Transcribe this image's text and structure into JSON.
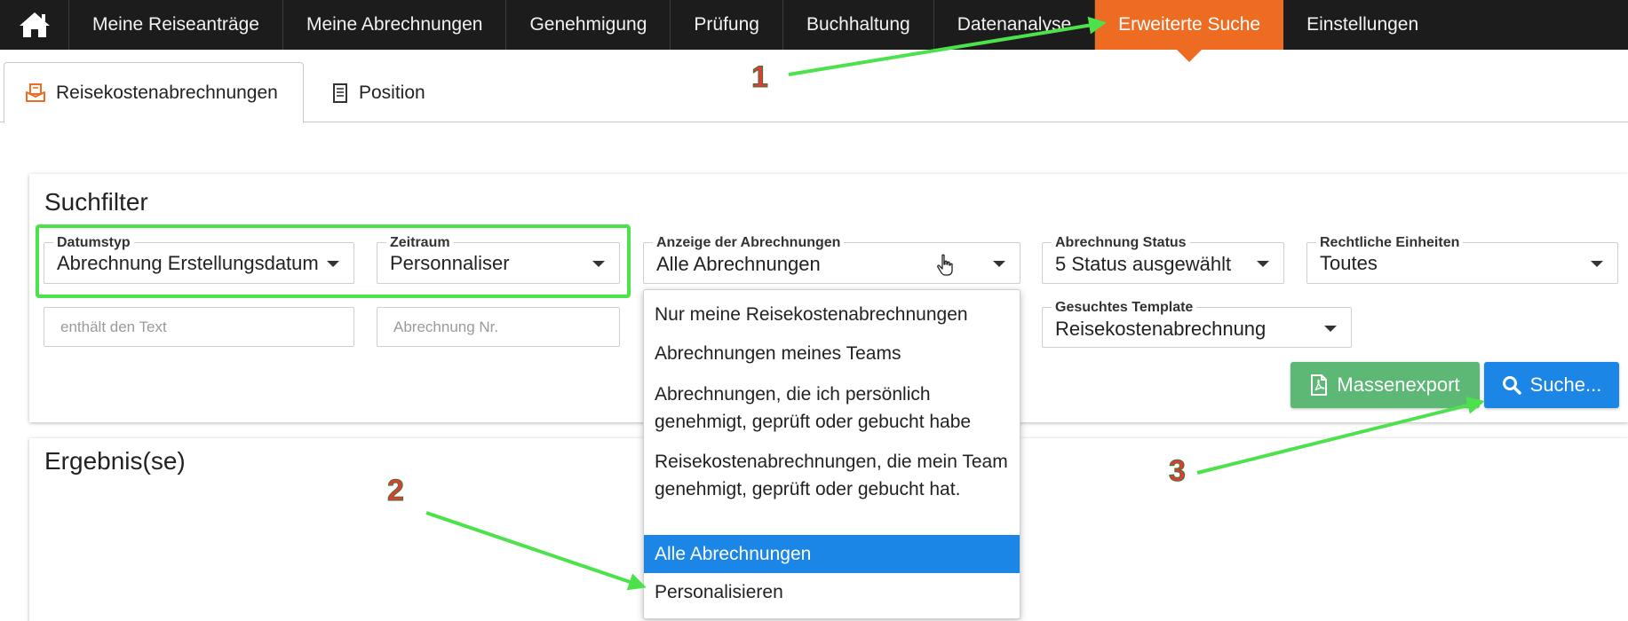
{
  "nav": {
    "items": [
      "Meine Reiseanträge",
      "Meine Abrechnungen",
      "Genehmigung",
      "Prüfung",
      "Buchhaltung",
      "Datenanalyse",
      "Erweiterte Suche",
      "Einstellungen"
    ],
    "active_index": 6,
    "active_color": "#ee6c22",
    "home_icon": "home-icon"
  },
  "tabs": {
    "items": [
      {
        "label": "Reisekostenabrechnungen",
        "icon": "envelope-receipt-icon"
      },
      {
        "label": "Position",
        "icon": "document-icon"
      }
    ],
    "active_index": 0
  },
  "filter": {
    "title": "Suchfilter",
    "date_type": {
      "label": "Datumstyp",
      "value": "Abrechnung Erstellungsdatum"
    },
    "period": {
      "label": "Zeitraum",
      "value": "Personnaliser"
    },
    "display": {
      "label": "Anzeige der Abrechnungen",
      "value": "Alle Abrechnungen"
    },
    "status": {
      "label": "Abrechnung Status",
      "value": "5 Status ausgewählt"
    },
    "legal_entities": {
      "label": "Rechtliche Einheiten",
      "value": "Toutes"
    },
    "text_search": {
      "placeholder": "enthält den Text"
    },
    "number_search": {
      "placeholder": "Abrechnung Nr."
    },
    "template": {
      "label": "Gesuchtes Template",
      "value": "Reisekostenabrechnung"
    },
    "export_button": "Massenexport",
    "search_button": "Suche..."
  },
  "dropdown": {
    "options": [
      "Nur meine Reisekostenabrechnungen",
      "Abrechnungen meines Teams",
      "Abrechnungen, die ich persönlich genehmigt, geprüft oder gebucht habe",
      "Reisekostenabrechnungen, die mein Team genehmigt, geprüft oder gebucht hat.",
      "Alle Abrechnungen",
      "Personalisieren"
    ],
    "selected_index": 4,
    "selected_color": "#1c86e6"
  },
  "results": {
    "title": "Ergebnis(se)"
  },
  "annotations": {
    "steps": [
      "1",
      "2",
      "3"
    ],
    "arrow_color": "#4ce24c",
    "number_color": "#e53935"
  }
}
